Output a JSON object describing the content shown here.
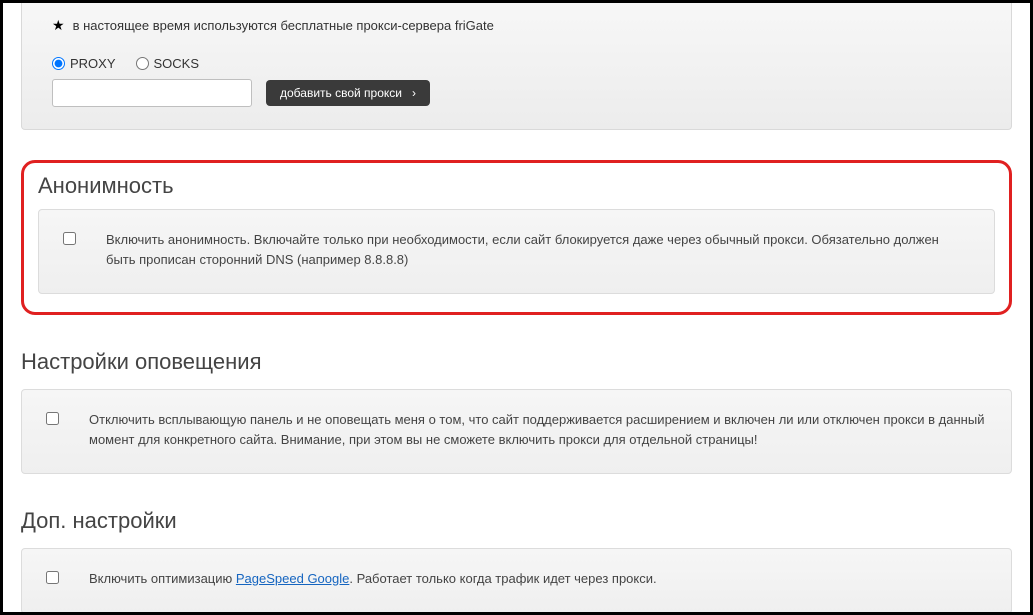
{
  "top_panel": {
    "star_note": "в настоящее время используются бесплатные прокси-сервера friGate",
    "radio_proxy_label": "PROXY",
    "radio_socks_label": "SOCKS",
    "radio_selected": "proxy",
    "proxy_input_value": "",
    "proxy_input_placeholder": "",
    "add_button_label": "добавить свой прокси"
  },
  "sections": {
    "anonymity": {
      "title": "Анонимность",
      "checkbox_text": "Включить анонимность. Включайте только при необходимости, если сайт блокируется даже через обычный прокси. Обязательно должен быть прописан сторонний DNS (например 8.8.8.8)"
    },
    "notifications": {
      "title": "Настройки оповещения",
      "checkbox_text": "Отключить всплывающую панель и не оповещать меня о том, что сайт поддерживается расширением и включен ли или отключен прокси в данный момент для конкретного сайта. Внимание, при этом вы не сможете включить прокси для отдельной страницы!"
    },
    "additional": {
      "title": "Доп. настройки",
      "checkbox_text_before": "Включить оптимизацию ",
      "link_text": "PageSpeed Google",
      "checkbox_text_after": ". Работает только когда трафик идет через прокси."
    }
  }
}
